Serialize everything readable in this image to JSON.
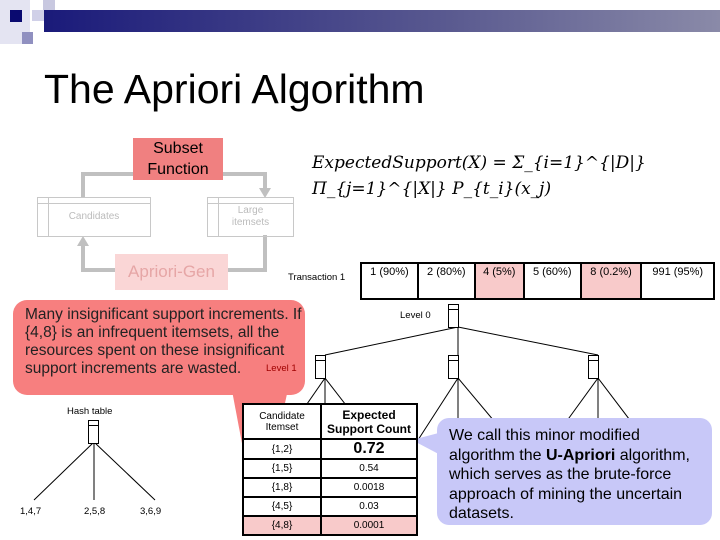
{
  "slide": {
    "title": "The Apriori Algorithm"
  },
  "diagram": {
    "subset_function": "Subset Function",
    "candidates": "Candidates",
    "large_itemsets": "Large itemsets",
    "apriori_gen": "Apriori-Gen"
  },
  "formula": {
    "text": "ExpectedSupport(X) = Σ_{i=1}^{|D|} Π_{j=1}^{|X|} P_{t_i}(x_j)"
  },
  "transaction": {
    "label": "Transaction 1",
    "cells": [
      {
        "text": "1 (90%)",
        "highlight": false
      },
      {
        "text": "2 (80%)",
        "highlight": false
      },
      {
        "text": "4 (5%)",
        "highlight": true
      },
      {
        "text": "5 (60%)",
        "highlight": false
      },
      {
        "text": "8 (0.2%)",
        "highlight": true
      },
      {
        "text": "991 (95%)",
        "highlight": false
      }
    ]
  },
  "tree": {
    "level0": "Level 0",
    "level1": "Level 1",
    "hash_table": "Hash table",
    "leaves": [
      "1,4,7",
      "2,5,8",
      "3,6,9"
    ]
  },
  "callout_red": {
    "text": "Many insignificant support increments. If {4,8} is an infrequent itemsets, all the resources spent on these insignificant support increments are wasted.",
    "color": "#f77f7f"
  },
  "candidate_table": {
    "headers": [
      "Candidate Itemset",
      "Expected Support Count"
    ],
    "rows": [
      {
        "itemset": "{1,2}",
        "count": "0.72",
        "highlight": false
      },
      {
        "itemset": "{1,5}",
        "count": "0.54",
        "highlight": false
      },
      {
        "itemset": "{1,8}",
        "count": "0.0018",
        "highlight": false
      },
      {
        "itemset": "{4,5}",
        "count": "0.03",
        "highlight": false
      },
      {
        "itemset": "{4,8}",
        "count": "0.0001",
        "highlight": true
      }
    ]
  },
  "callout_blue": {
    "pre": "We call this minor modified algorithm the ",
    "bold": "U-Apriori",
    "post": " algorithm, which serves as the brute-force approach of mining the uncertain datasets.",
    "color": "#c8c8f8"
  }
}
